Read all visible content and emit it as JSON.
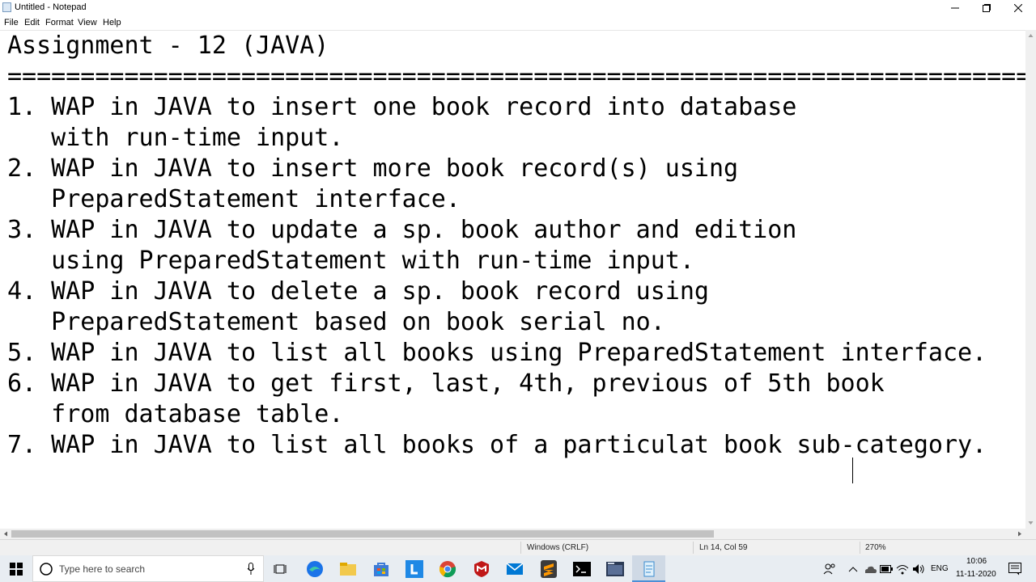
{
  "window": {
    "title": "Untitled - Notepad",
    "minimize_glyph": "—",
    "maximize_glyph": "☐",
    "close_glyph": "✕"
  },
  "menu": {
    "items": [
      "File",
      "Edit",
      "Format",
      "View",
      "Help"
    ]
  },
  "document": {
    "lines": [
      "Assignment - 12 (JAVA)",
      "=========================================================================================",
      "1. WAP in JAVA to insert one book record into database",
      "   with run-time input.",
      "2. WAP in JAVA to insert more book record(s) using",
      "   PreparedStatement interface.",
      "3. WAP in JAVA to update a sp. book author and edition",
      "   using PreparedStatement with run-time input.",
      "4. WAP in JAVA to delete a sp. book record using",
      "   PreparedStatement based on book serial no.",
      "5. WAP in JAVA to list all books using PreparedStatement interface.",
      "6. WAP in JAVA to get first, last, 4th, previous of 5th book",
      "   from database table.",
      "7. WAP in JAVA to list all books of a particulat book sub-category."
    ]
  },
  "status": {
    "encoding": "Windows (CRLF)",
    "position": "Ln 14, Col 59",
    "zoom": "270%"
  },
  "taskbar": {
    "search_placeholder": "Type here to search",
    "language": "ENG",
    "time": "10:06",
    "date": "11-11-2020",
    "icons": [
      "windows-start-icon",
      "search-icon",
      "microphone-icon",
      "task-view-icon",
      "edge-icon",
      "file-explorer-icon",
      "microsoft-store-icon",
      "l-app-icon",
      "chrome-icon",
      "mcafee-icon",
      "mail-icon",
      "sublime-text-icon",
      "terminal-icon",
      "app-window-icon",
      "notepad-icon"
    ],
    "accent_color": "#1a73e8"
  }
}
